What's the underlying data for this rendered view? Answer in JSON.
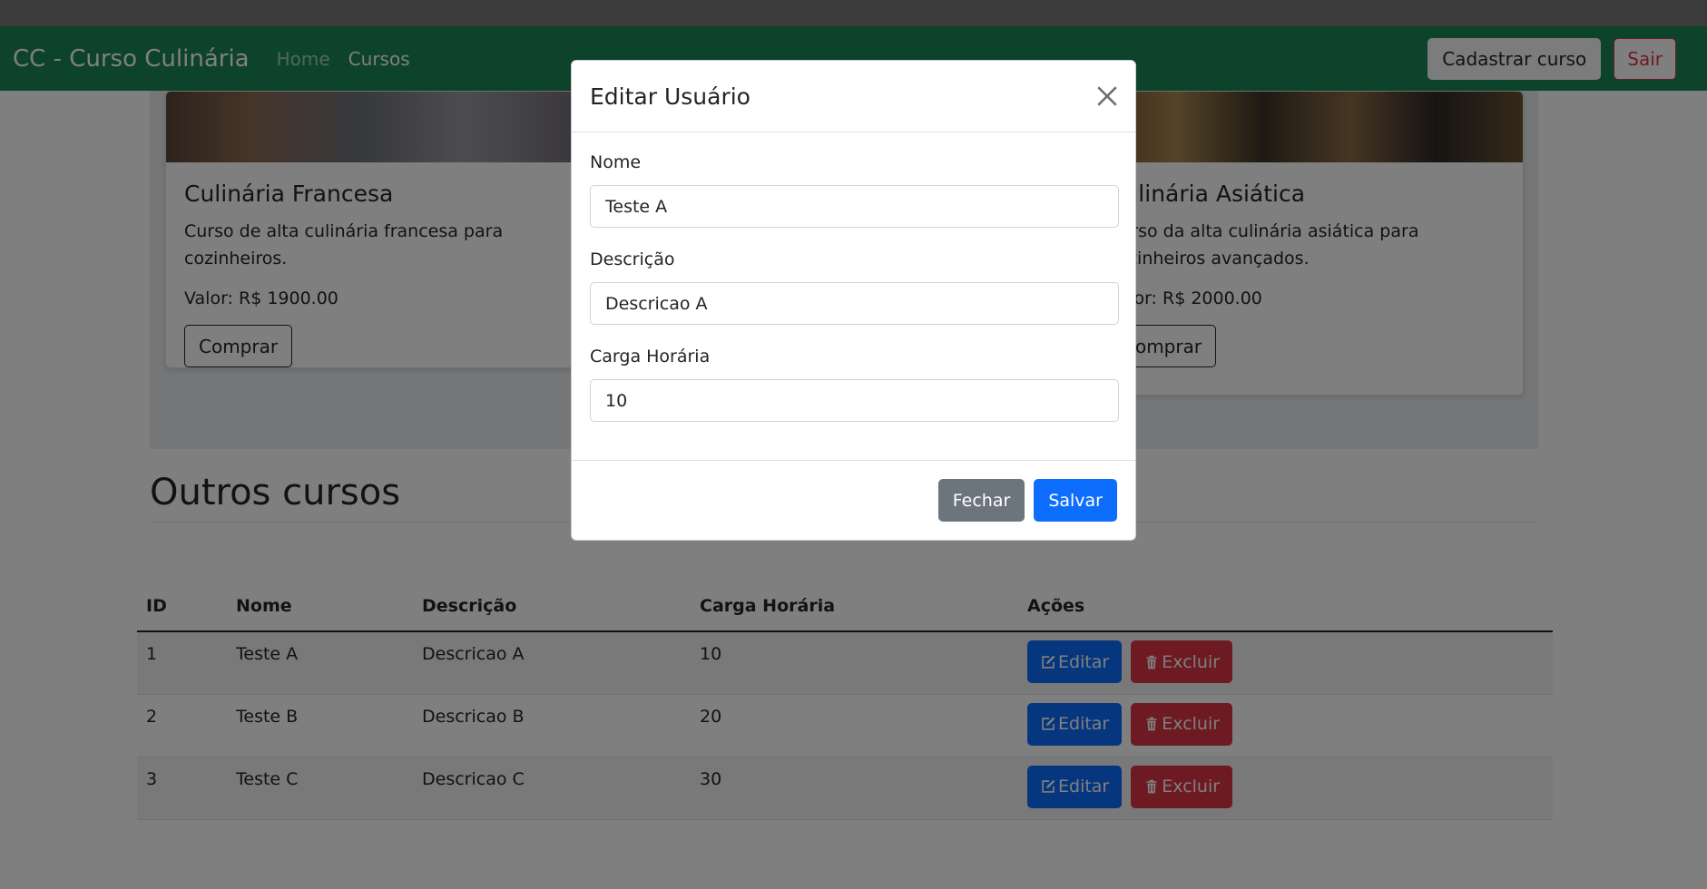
{
  "navbar": {
    "brand": "CC - Curso Culinária",
    "links": [
      {
        "label": "Home",
        "active": false
      },
      {
        "label": "Cursos",
        "active": true
      }
    ],
    "register_course_label": "Cadastrar curso",
    "logout_label": "Sair"
  },
  "cards": [
    {
      "title": "Culinária Francesa",
      "text": "Curso de alta culinária francesa para cozinheiros.",
      "price": "Valor: R$ 1900.00",
      "button": "Comprar"
    },
    {
      "title": "Culinária Asiática",
      "text": "Curso da alta culinária asiática para cozinheiros avançados.",
      "price": "Valor: R$ 2000.00",
      "button": "Comprar"
    }
  ],
  "section": {
    "title": "Outros cursos"
  },
  "table": {
    "headers": [
      "ID",
      "Nome",
      "Descrição",
      "Carga Horária",
      "Ações"
    ],
    "rows": [
      {
        "id": "1",
        "name": "Teste A",
        "description": "Descricao A",
        "hours": "10"
      },
      {
        "id": "2",
        "name": "Teste B",
        "description": "Descricao B",
        "hours": "20"
      },
      {
        "id": "3",
        "name": "Teste C",
        "description": "Descricao C",
        "hours": "30"
      }
    ],
    "edit_label": "Editar",
    "delete_label": "Excluir"
  },
  "modal": {
    "title": "Editar Usuário",
    "fields": {
      "name_label": "Nome",
      "name_value": "Teste A",
      "description_label": "Descrição",
      "description_value": "Descricao A",
      "hours_label": "Carga Horária",
      "hours_value": "10"
    },
    "close_label": "Fechar",
    "save_label": "Salvar"
  },
  "colors": {
    "navbar": "#198754",
    "primary": "#0d6efd",
    "danger": "#dc3545",
    "secondary": "#6c757d"
  }
}
